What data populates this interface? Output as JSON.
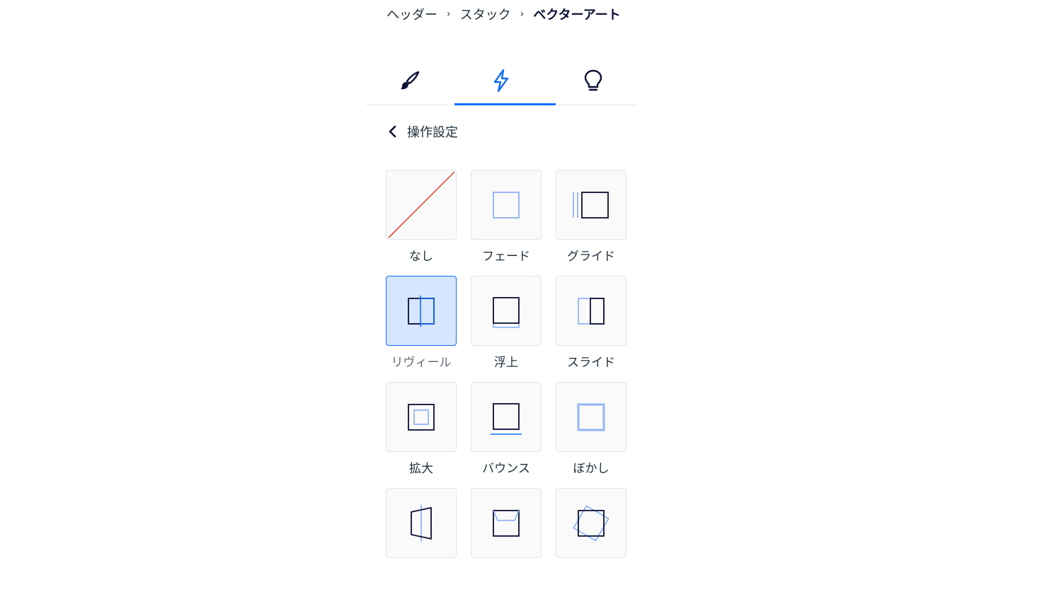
{
  "breadcrumb": {
    "items": [
      "ヘッダー",
      "スタック"
    ],
    "separator": "›",
    "current": "ベクターアート"
  },
  "tabs": [
    {
      "icon": "paintbrush-icon",
      "active": false
    },
    {
      "icon": "lightning-icon",
      "active": true
    },
    {
      "icon": "lightbulb-icon",
      "active": false
    }
  ],
  "back": {
    "label": "操作設定",
    "icon": "chevron-left-icon"
  },
  "animations": [
    {
      "label": "なし",
      "icon": "none-icon"
    },
    {
      "label": "フェード",
      "icon": "fade-icon"
    },
    {
      "label": "グライド",
      "icon": "glide-icon"
    },
    {
      "label": "リヴィール",
      "icon": "reveal-icon",
      "selected": true
    },
    {
      "label": "浮上",
      "icon": "float-icon"
    },
    {
      "label": "スライド",
      "icon": "slide-icon"
    },
    {
      "label": "拡大",
      "icon": "expand-icon"
    },
    {
      "label": "バウンス",
      "icon": "bounce-icon"
    },
    {
      "label": "ぼかし",
      "icon": "blur-icon"
    },
    {
      "label": "",
      "icon": "flip-icon"
    },
    {
      "label": "",
      "icon": "fold-icon"
    },
    {
      "label": "",
      "icon": "spin-icon"
    }
  ],
  "colors": {
    "accent": "#116dff",
    "selected_bg": "#d6e6fe",
    "icon_dark": "#0b0f33",
    "icon_light": "#7fa9f4",
    "none_line": "#e0271d"
  }
}
